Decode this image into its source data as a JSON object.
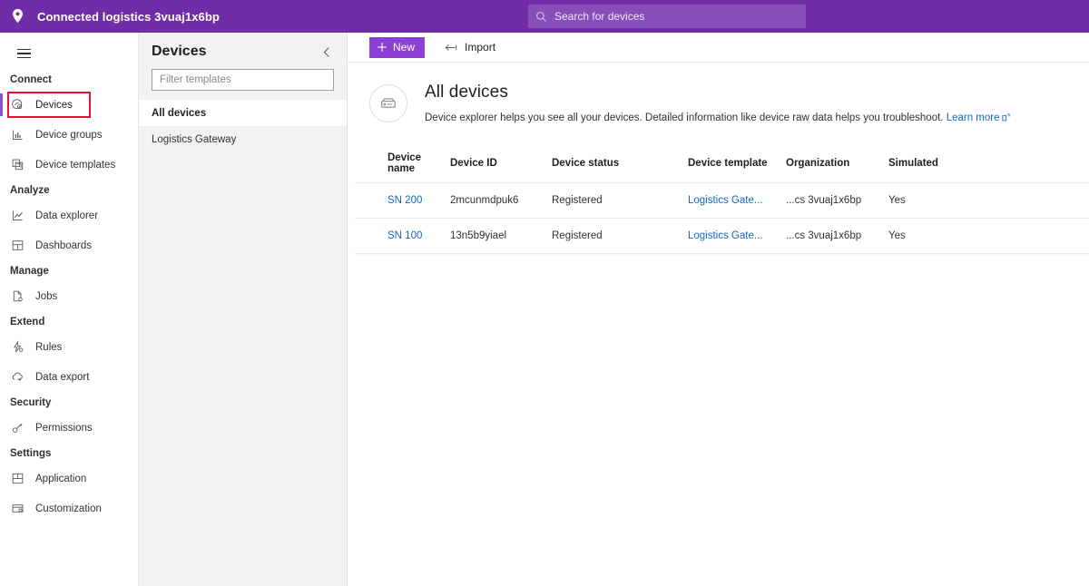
{
  "topbar": {
    "pin_icon": "location-pin-icon",
    "title": "Connected logistics 3vuaj1x6bp",
    "search": {
      "icon": "search-icon",
      "placeholder": "Search for devices",
      "value": "Search for devices"
    }
  },
  "sidebar": {
    "menu_icon": "hamburger-menu-icon",
    "groups": [
      {
        "label": "Connect",
        "items": [
          {
            "label": "Devices",
            "icon": "devices-icon",
            "selected": true,
            "highlighted": true
          },
          {
            "label": "Device groups",
            "icon": "device-groups-icon",
            "selected": false,
            "highlighted": false
          },
          {
            "label": "Device templates",
            "icon": "device-templates-icon",
            "selected": false,
            "highlighted": false
          }
        ]
      },
      {
        "label": "Analyze",
        "items": [
          {
            "label": "Data explorer",
            "icon": "line-chart-icon",
            "selected": false,
            "highlighted": false
          },
          {
            "label": "Dashboards",
            "icon": "dashboard-grid-icon",
            "selected": false,
            "highlighted": false
          }
        ]
      },
      {
        "label": "Manage",
        "items": [
          {
            "label": "Jobs",
            "icon": "jobs-document-icon",
            "selected": false,
            "highlighted": false
          }
        ]
      },
      {
        "label": "Extend",
        "items": [
          {
            "label": "Rules",
            "icon": "rules-lightning-icon",
            "selected": false,
            "highlighted": false
          },
          {
            "label": "Data export",
            "icon": "cloud-export-icon",
            "selected": false,
            "highlighted": false
          }
        ]
      },
      {
        "label": "Security",
        "items": [
          {
            "label": "Permissions",
            "icon": "key-icon",
            "selected": false,
            "highlighted": false
          }
        ]
      },
      {
        "label": "Settings",
        "items": [
          {
            "label": "Application",
            "icon": "application-layout-icon",
            "selected": false,
            "highlighted": false
          },
          {
            "label": "Customization",
            "icon": "customization-icon",
            "selected": false,
            "highlighted": false
          }
        ]
      }
    ]
  },
  "panel": {
    "title": "Devices",
    "collapse_icon": "chevron-left-icon",
    "filter_placeholder": "Filter templates",
    "filter_value": "",
    "items": [
      {
        "label": "All devices",
        "selected": true
      },
      {
        "label": "Logistics Gateway",
        "selected": false
      }
    ]
  },
  "toolbar": {
    "new_label": "New",
    "new_icon": "plus-icon",
    "import_label": "Import",
    "import_icon": "import-arrow-icon"
  },
  "hero": {
    "icon": "device-box-icon",
    "title": "All devices",
    "description": "Device explorer helps you see all your devices. Detailed information like device raw data helps you troubleshoot.",
    "link_label": "Learn more",
    "link_icon": "external-link-icon"
  },
  "table": {
    "columns": [
      "Device name",
      "Device ID",
      "Device status",
      "Device template",
      "Organization",
      "Simulated"
    ],
    "rows": [
      {
        "device_name": "SN 200",
        "device_id": "2mcunmdpuk6",
        "device_status": "Registered",
        "device_template": "Logistics Gate...",
        "organization": "...cs 3vuaj1x6bp",
        "simulated": "Yes"
      },
      {
        "device_name": "SN 100",
        "device_id": "13n5b9yiael",
        "device_status": "Registered",
        "device_template": "Logistics Gate...",
        "organization": "...cs 3vuaj1x6bp",
        "simulated": "Yes"
      }
    ]
  },
  "colors": {
    "header_purple": "#6f2da8",
    "button_purple": "#8c3fd1",
    "accent_purple": "#8c52c9",
    "highlight_red": "#e8112d",
    "link_blue": "#1267c6",
    "panel_gray": "#f3f2f1"
  }
}
